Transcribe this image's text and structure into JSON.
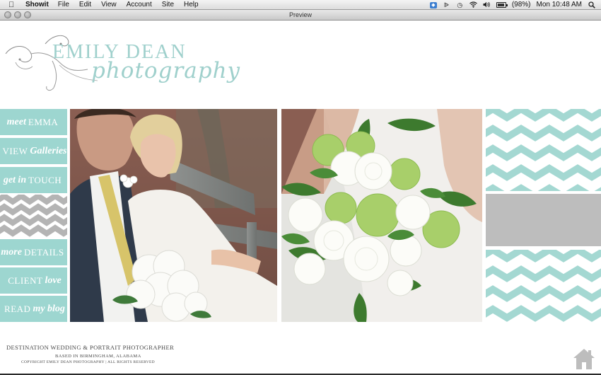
{
  "menubar": {
    "app_name": "Showit",
    "items": [
      "File",
      "Edit",
      "View",
      "Account",
      "Site",
      "Help"
    ],
    "battery": "(98%)",
    "clock": "Mon 10:48 AM"
  },
  "window": {
    "title": "Preview"
  },
  "logo": {
    "name": "EMILY DEAN",
    "script": "photography"
  },
  "nav": {
    "items": [
      {
        "a": "meet",
        "b": "EMMA",
        "order": "ab"
      },
      {
        "a": "Galleries",
        "b": "VIEW",
        "order": "ba"
      },
      {
        "a": "get in",
        "b": "TOUCH",
        "order": "ab"
      },
      {
        "a": "more",
        "b": "DETAILS",
        "order": "ab"
      },
      {
        "a": "love",
        "b": "CLIENT",
        "order": "ba"
      },
      {
        "a": "my blog",
        "b": "READ",
        "order": "ba"
      }
    ]
  },
  "footer": {
    "line1": "DESTINATION WEDDING & PORTRAIT PHOTOGRAPHER",
    "line2": "BASED IN BIRMINGHAM, ALABAMA",
    "line3": "COPYRIGHT EMILY DEAN PHOTOGRAPHY | ALL RIGHTS RESERVED"
  },
  "colors": {
    "accent": "#9dd6d0",
    "chevron_grey": "#b4b4b4",
    "grey_block": "#bdbdbd"
  },
  "icons": {
    "apple": "apple-logo-icon",
    "home": "home-icon"
  }
}
